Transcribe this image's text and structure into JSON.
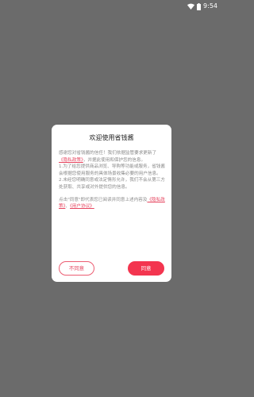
{
  "status_bar": {
    "time": "9:54",
    "icons": [
      "wifi-icon",
      "battery-icon"
    ]
  },
  "dialog": {
    "title": "欢迎使用省钱酱",
    "paragraph1_part1": "感谢您对省钱酱的信任！我们依据监管要求更新了",
    "paragraph1_link": "《隐私政策》",
    "paragraph1_part2": "，并据此使用和保护您的信息。",
    "paragraph2": "1.为了给您提供商品浏览、导购等功能或服务，省钱酱会根据您使用服务的具体场景收集必要的用户信息。",
    "paragraph3": "2.未经您明确同意或法定情形允许，我们不会从第三方处获取、共享或对外提供您的信息。",
    "notice_part1": "点击\"同意\"即代表您已阅读并同意上述内容及",
    "notice_link1": "《隐私政策》",
    "notice_sep": "、",
    "notice_link2": "《用户协议》",
    "disagree_label": "不同意",
    "agree_label": "同意"
  },
  "colors": {
    "overlay": "#6b6b6b",
    "accent": "#f3354f",
    "link": "#e6455f"
  }
}
